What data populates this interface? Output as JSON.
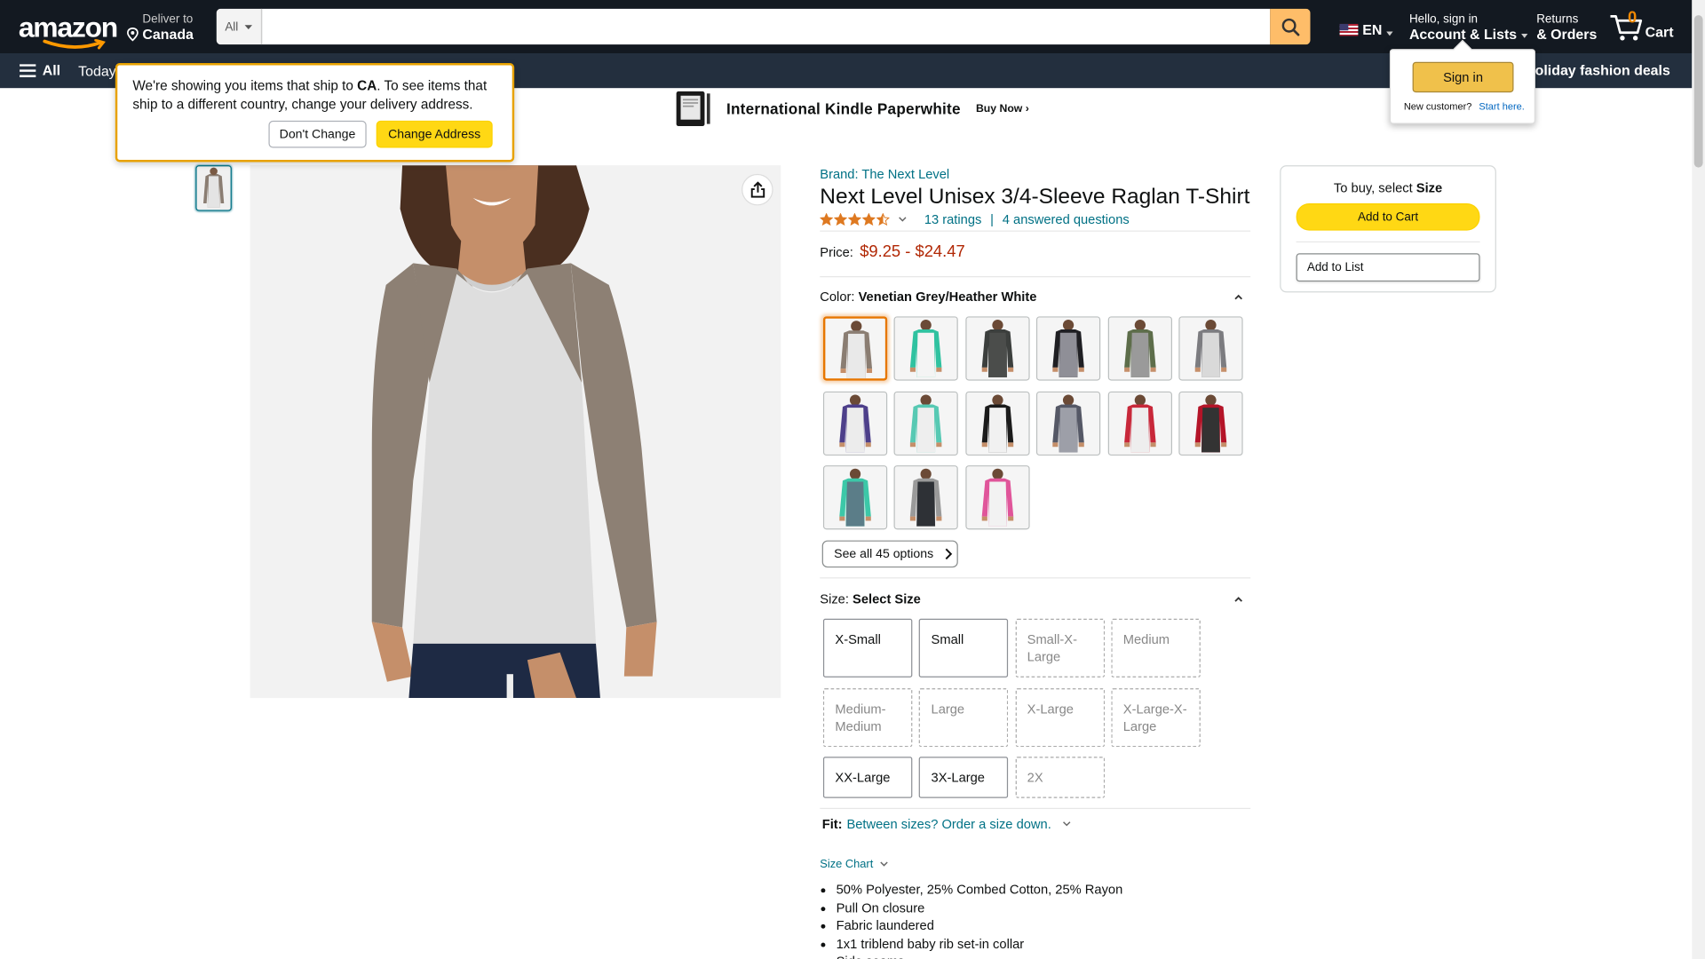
{
  "header": {
    "logo": "amazon",
    "deliver_to_label": "Deliver to",
    "deliver_to_value": "Canada",
    "search_category": "All",
    "search_placeholder": "",
    "language": "EN",
    "account_greeting": "Hello, sign in",
    "account_label": "Account & Lists",
    "returns_label": "Returns",
    "orders_label": "& Orders",
    "cart_count": "0",
    "cart_label": "Cart",
    "accent_color": "#febd69"
  },
  "subnav": {
    "all_label": "All",
    "today_label": "Today's",
    "deals_label": "o holiday fashion deals"
  },
  "ship_popover": {
    "text_1": "We're showing you items that ship to ",
    "country": "CA",
    "text_2": ". To see items that ship to a different country, change your delivery address.",
    "dont_change": "Don't Change",
    "change_address": "Change Address"
  },
  "signin_popover": {
    "button": "Sign in",
    "new_customer": "New customer?",
    "start_here": "Start here."
  },
  "banner": {
    "title": "International Kindle Paperwhite",
    "cta": "Buy Now ›"
  },
  "product": {
    "brand": "Brand: The Next Level",
    "title": "Next Level Unisex 3/4-Sleeve Raglan T-Shirt",
    "rating_stars": 4.5,
    "ratings_count": "13 ratings",
    "separator": "|",
    "answered": "4 answered questions",
    "price_label": "Price:",
    "price_value": "$9.25 - $24.47",
    "color_label": "Color:",
    "color_value": "Venetian Grey/Heather White",
    "see_all": "See all 45 options",
    "size_label": "Size:",
    "size_value": "Select Size",
    "fit_label": "Fit:",
    "fit_link": "Between sizes? Order a size down.",
    "size_chart": "Size Chart",
    "sizes": [
      {
        "label": "X-Small",
        "available": true
      },
      {
        "label": "Small",
        "available": true
      },
      {
        "label": "Small-X-Large",
        "available": false
      },
      {
        "label": "Medium",
        "available": false
      },
      {
        "label": "Medium-Medium",
        "available": false
      },
      {
        "label": "Large",
        "available": false
      },
      {
        "label": "X-Large",
        "available": false
      },
      {
        "label": "X-Large-X-Large",
        "available": false
      },
      {
        "label": "XX-Large",
        "available": true
      },
      {
        "label": "3X-Large",
        "available": true
      },
      {
        "label": "2X",
        "available": false
      }
    ],
    "swatches": [
      {
        "sleeve": "#8a7d72",
        "body": "#e9e9e9",
        "selected": true
      },
      {
        "sleeve": "#2fc2a0",
        "body": "#f4f4f4",
        "selected": false
      },
      {
        "sleeve": "#3c3f3d",
        "body": "#4b4d4b",
        "selected": false
      },
      {
        "sleeve": "#1f1f23",
        "body": "#8f8f97",
        "selected": false
      },
      {
        "sleeve": "#5d6d4a",
        "body": "#9a9a9a",
        "selected": false
      },
      {
        "sleeve": "#7c7c80",
        "body": "#d9d9d9",
        "selected": false
      },
      {
        "sleeve": "#4d3f8a",
        "body": "#ececec",
        "selected": false
      },
      {
        "sleeve": "#57c9b3",
        "body": "#eeeeee",
        "selected": false
      },
      {
        "sleeve": "#1b1b1b",
        "body": "#f1f1f1",
        "selected": false
      },
      {
        "sleeve": "#555866",
        "body": "#9d9fa8",
        "selected": false
      },
      {
        "sleeve": "#c8283a",
        "body": "#eeeeee",
        "selected": false
      },
      {
        "sleeve": "#b41428",
        "body": "#333333",
        "selected": false
      },
      {
        "sleeve": "#3cc8a8",
        "body": "#5b7d88",
        "selected": false
      },
      {
        "sleeve": "#9a9a9a",
        "body": "#2e3136",
        "selected": false
      },
      {
        "sleeve": "#e0559a",
        "body": "#f2f2f2",
        "selected": false
      }
    ],
    "bullets": [
      "50% Polyester, 25% Combed Cotton, 25% Rayon",
      "Pull On closure",
      "Fabric laundered",
      "1x1 triblend baby rib set-in collar",
      "Side seams"
    ]
  },
  "buybox": {
    "to_buy": "To buy, select",
    "to_buy_strong": "Size",
    "add_to_cart": "Add to Cart",
    "add_to_list": "Add to List"
  }
}
